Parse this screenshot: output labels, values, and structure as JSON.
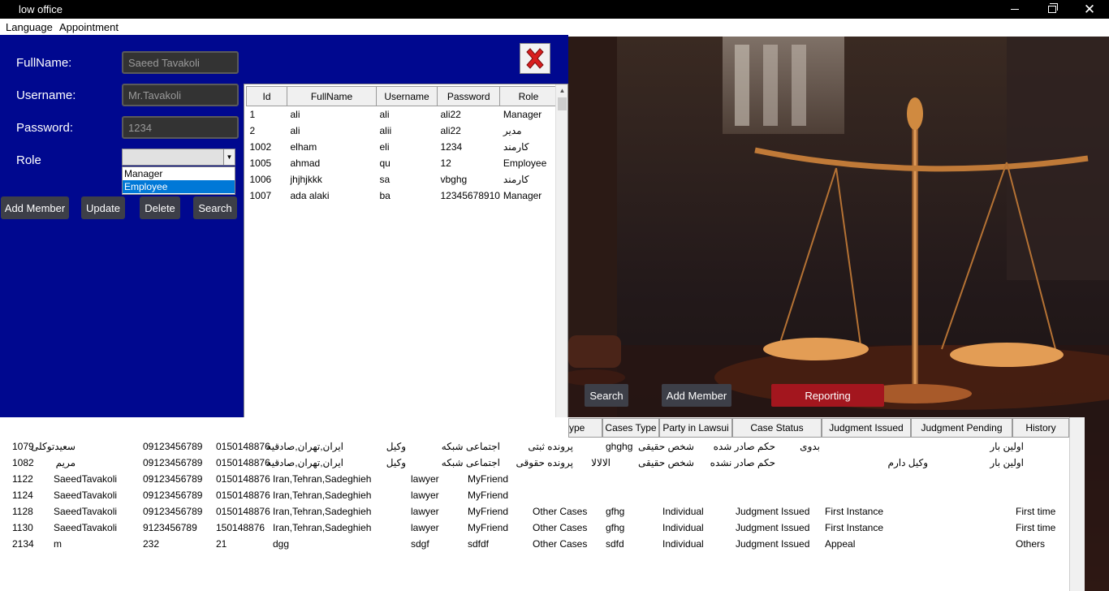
{
  "window": {
    "title": "low office"
  },
  "menu": {
    "language": "Language",
    "appointment": "Appointment"
  },
  "form": {
    "fullname_label": "FullName:",
    "fullname_value": "Saeed Tavakoli",
    "username_label": "Username:",
    "username_value": "Mr.Tavakoli",
    "password_label": "Password:",
    "password_value": "1234",
    "role_label": "Role",
    "role_value": "",
    "role_options": [
      "Manager",
      "Employee"
    ],
    "role_selected_index": 1
  },
  "buttons": {
    "add_member": "Add Member",
    "update": "Update",
    "delete": "Delete",
    "search": "Search",
    "search2": "Search",
    "add_member2": "Add Member",
    "reporting": "Reporting"
  },
  "users_table": {
    "columns": [
      "Id",
      "FullName",
      "Username",
      "Password",
      "Role"
    ],
    "rows": [
      [
        "1",
        "ali",
        "ali",
        "ali22",
        "Manager"
      ],
      [
        "2",
        "ali",
        "alii",
        "ali22",
        "مدیر"
      ],
      [
        "1002",
        "elham",
        "eli",
        "1234",
        "کارمند"
      ],
      [
        "1005",
        "ahmad",
        "qu",
        "12",
        "Employee"
      ],
      [
        "1006",
        "jhjhjkkk",
        "sa",
        "vbghg",
        "کارمند"
      ],
      [
        "1007",
        "ada alaki",
        "ba",
        "12345678910",
        "Manager"
      ]
    ]
  },
  "cases_table": {
    "columns": [
      "ype",
      "Cases Type",
      "Party in Lawsui",
      "Case Status",
      "Judgment Issued",
      "Judgment Pending",
      "History"
    ],
    "rows": [
      [
        "1079",
        "سعیدتوکلی",
        "09123456789",
        "0150148876",
        "ایران,تهران,صادقیه",
        "وکیل",
        "اجتماعی شبکه",
        "پرونده ثبتی",
        "ghghg",
        "شخص حقیقی",
        "حکم صادر شده",
        "بدوی",
        "",
        "اولین بار"
      ],
      [
        "1082",
        "مریم",
        "09123456789",
        "0150148876",
        "ایران,تهران,صادقیه",
        "وکیل",
        "اجتماعی شبکه",
        "پرونده حقوقی",
        "الالالا",
        "شخص حقیقی",
        "حکم صادر نشده",
        "",
        "وکیل دارم",
        "اولین بار"
      ],
      [
        "1122",
        "SaeedTavakoli",
        "09123456789",
        "0150148876",
        "Iran,Tehran,Sadeghieh",
        "lawyer",
        "MyFriend",
        "",
        "",
        "",
        "",
        "",
        "",
        ""
      ],
      [
        "1124",
        "SaeedTavakoli",
        "09123456789",
        "0150148876",
        "Iran,Tehran,Sadeghieh",
        "lawyer",
        "MyFriend",
        "",
        "",
        "",
        "",
        "",
        "",
        ""
      ],
      [
        "1128",
        "SaeedTavakoli",
        "09123456789",
        "0150148876",
        "Iran,Tehran,Sadeghieh",
        "lawyer",
        "MyFriend",
        "Other Cases",
        "gfhg",
        "Individual",
        "Judgment Issued",
        "First Instance",
        "",
        "First time"
      ],
      [
        "1130",
        "SaeedTavakoli",
        "9123456789",
        "150148876",
        "Iran,Tehran,Sadeghieh",
        "lawyer",
        "MyFriend",
        "Other Cases",
        "gfhg",
        "Individual",
        "Judgment Issued",
        "First Instance",
        "",
        "First time"
      ],
      [
        "2134",
        "m",
        "232",
        "21",
        "dgg",
        "sdgf",
        "sdfdf",
        "Other Cases",
        "sdfd",
        "Individual",
        "Judgment Issued",
        "Appeal",
        "",
        "Others"
      ]
    ]
  },
  "colors": {
    "panel_bg": "#00088f",
    "button_bg": "#3d3f48",
    "reporting_bg": "#a3161e",
    "selection": "#0078d7"
  },
  "icons": {
    "close_panel": "red-x-icon",
    "combo_arrow": "chevron-down-icon"
  }
}
